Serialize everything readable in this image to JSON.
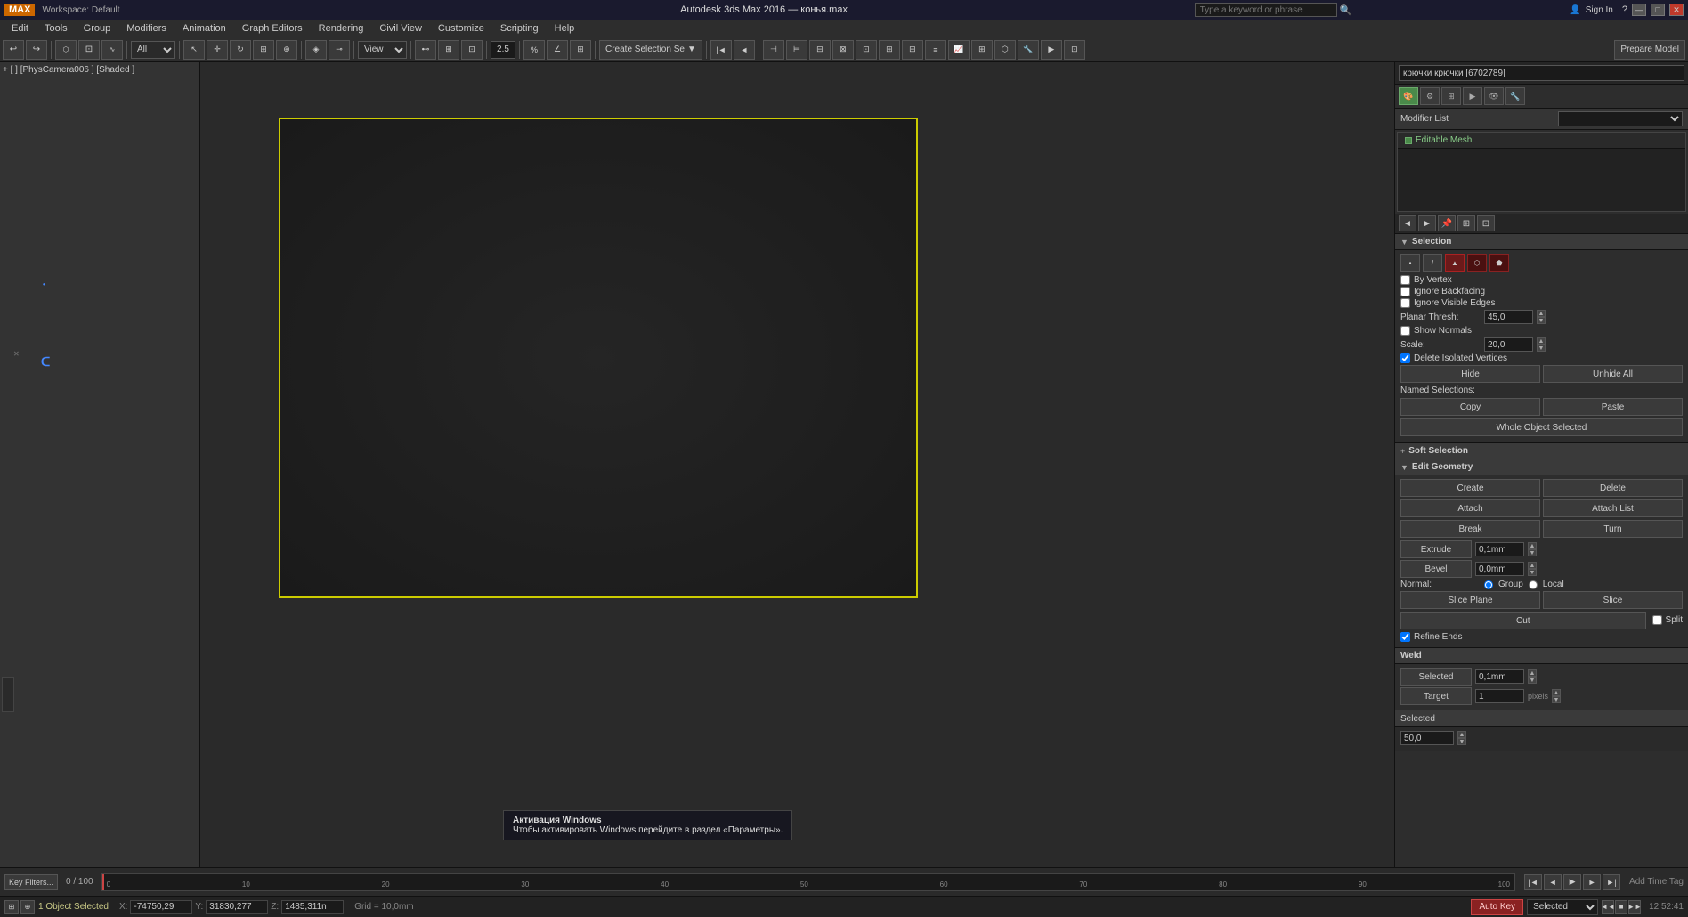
{
  "titlebar": {
    "app_name": "MAX",
    "workspace": "Workspace: Default",
    "title": "Autodesk 3ds Max 2016  —  конья.max",
    "search_placeholder": "Type a keyword or phrase",
    "signin": "Sign In"
  },
  "menubar": {
    "items": [
      "Edit",
      "Tools",
      "Group",
      "Modifiers",
      "Animation",
      "Graph Editors",
      "Rendering",
      "Civil View",
      "Customize",
      "Scripting",
      "Help"
    ]
  },
  "toolbar1": {
    "undo_label": "↩",
    "redo_label": "↪",
    "select_filter": "All",
    "view_dropdown": "View",
    "create_selection": "Create Selection Se",
    "number_value": "2.5"
  },
  "viewport": {
    "label": "+ [ ] [PhysCamera006 ] [Shaded ]",
    "grid_info": "Grid = 10,0mm"
  },
  "right_panel": {
    "object_name": "крючки крючки [6702789]",
    "modifier_list_label": "Modifier List",
    "modifier_item": "Editable Mesh",
    "section_selection": {
      "title": "Selection",
      "checkboxes": [
        {
          "label": "By Vertex",
          "checked": false
        },
        {
          "label": "Ignore Backfacing",
          "checked": false
        },
        {
          "label": "Ignore Visible Edges",
          "checked": false
        },
        {
          "label": "Show Normals",
          "checked": false
        },
        {
          "label": "Delete Isolated Vertices",
          "checked": true
        }
      ],
      "planar_thresh_label": "Planar Thresh:",
      "planar_thresh_value": "45,0",
      "scale_label": "Scale:",
      "scale_value": "20,0",
      "hide_btn": "Hide",
      "unhide_all_btn": "Unhide All",
      "named_sel_title": "Named Selections:",
      "copy_btn": "Copy",
      "paste_btn": "Paste",
      "whole_object_btn": "Whole Object Selected"
    },
    "section_soft_sel": {
      "title": "Soft Selection"
    },
    "section_edit_geom": {
      "title": "Edit Geometry",
      "create_btn": "Create",
      "delete_btn": "Delete",
      "attach_btn": "Attach",
      "attach_list_btn": "Attach List",
      "break_btn": "Break",
      "turn_btn": "Turn",
      "extrude_btn": "Extrude",
      "extrude_value": "0,1mm",
      "bevel_btn": "Bevel",
      "bevel_value": "0,0mm",
      "normal_label": "Normal:",
      "normal_group": "Group",
      "normal_local": "Local",
      "slice_plane_btn": "Slice Plane",
      "slice_btn": "Slice",
      "cut_btn": "Cut",
      "split_btn": "Split",
      "refine_ends_label": "Refine Ends",
      "refine_ends_checked": true
    },
    "section_weld": {
      "title": "Weld",
      "selected_label": "Selected",
      "selected_value": "0,1mm",
      "target_label": "Target",
      "target_value": "1",
      "target_unit": "pixels"
    },
    "section_bottom": {
      "title": "Selected",
      "value": "50,0"
    }
  },
  "timeline": {
    "start": "0",
    "end": "100",
    "current": "0 / 100",
    "ticks": [
      "0",
      "10",
      "20",
      "30",
      "40",
      "50",
      "60",
      "70",
      "80",
      "90",
      "100"
    ]
  },
  "statusbar": {
    "object_count": "1 Object Selected",
    "auto_key": "Auto Key",
    "selected_label": "Selected",
    "time": "12:52:41",
    "x_label": "X:",
    "x_value": "-74750,29",
    "y_label": "Y:",
    "y_value": "31830,277",
    "z_label": "Z:",
    "z_value": "1485,311n",
    "grid_label": "Grid = 10,0mm"
  },
  "activation_msg": {
    "line1": "Активация Windows",
    "line2": "Чтобы активировать Windows перейдите в раздел «Параметры»."
  }
}
